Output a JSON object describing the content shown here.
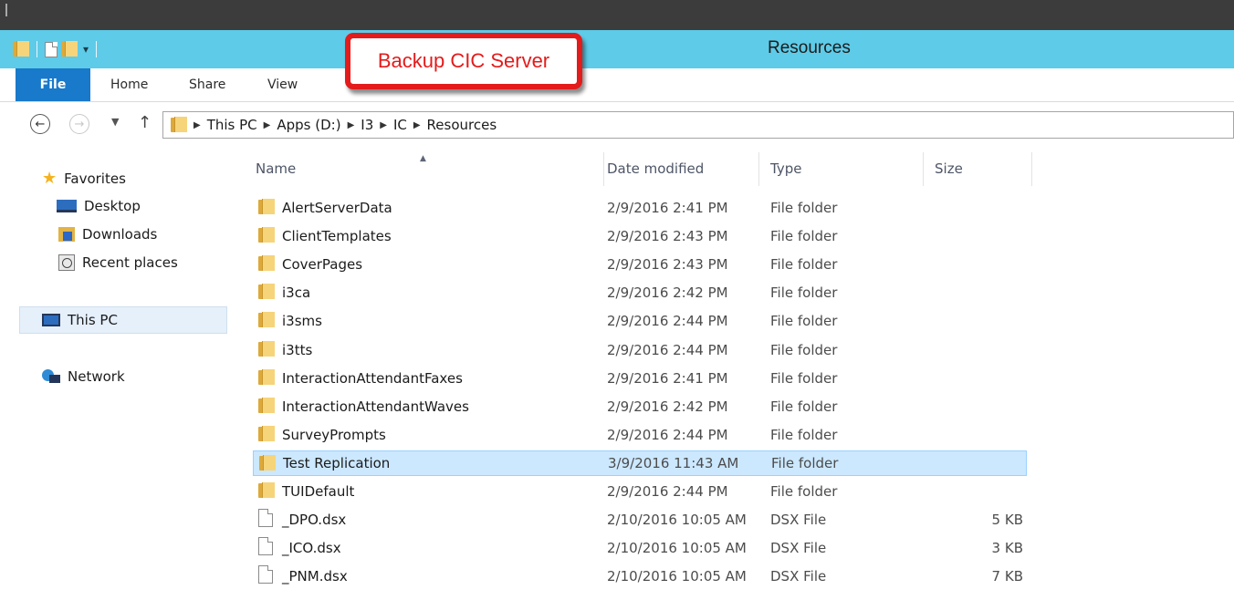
{
  "window": {
    "title": "Resources"
  },
  "ribbon": {
    "tabs": [
      {
        "label": "File"
      },
      {
        "label": "Home"
      },
      {
        "label": "Share"
      },
      {
        "label": "View"
      }
    ]
  },
  "annotation": {
    "callout_text": "Backup CIC Server",
    "color": "#e41b1b"
  },
  "address": {
    "breadcrumbs": [
      "This PC",
      "Apps (D:)",
      "I3",
      "IC",
      "Resources"
    ]
  },
  "navpane": {
    "favorites_label": "Favorites",
    "favorites": [
      {
        "label": "Desktop",
        "icon": "desktop-icon"
      },
      {
        "label": "Downloads",
        "icon": "downloads-icon"
      },
      {
        "label": "Recent places",
        "icon": "recent-places-icon"
      }
    ],
    "this_pc_label": "This PC",
    "network_label": "Network"
  },
  "columns": {
    "name": "Name",
    "date": "Date modified",
    "type": "Type",
    "size": "Size"
  },
  "files": [
    {
      "name": "AlertServerData",
      "date": "2/9/2016 2:41 PM",
      "type": "File folder",
      "size": "",
      "kind": "folder"
    },
    {
      "name": "ClientTemplates",
      "date": "2/9/2016 2:43 PM",
      "type": "File folder",
      "size": "",
      "kind": "folder"
    },
    {
      "name": "CoverPages",
      "date": "2/9/2016 2:43 PM",
      "type": "File folder",
      "size": "",
      "kind": "folder"
    },
    {
      "name": "i3ca",
      "date": "2/9/2016 2:42 PM",
      "type": "File folder",
      "size": "",
      "kind": "folder"
    },
    {
      "name": "i3sms",
      "date": "2/9/2016 2:44 PM",
      "type": "File folder",
      "size": "",
      "kind": "folder"
    },
    {
      "name": "i3tts",
      "date": "2/9/2016 2:44 PM",
      "type": "File folder",
      "size": "",
      "kind": "folder"
    },
    {
      "name": "InteractionAttendantFaxes",
      "date": "2/9/2016 2:41 PM",
      "type": "File folder",
      "size": "",
      "kind": "folder"
    },
    {
      "name": "InteractionAttendantWaves",
      "date": "2/9/2016 2:42 PM",
      "type": "File folder",
      "size": "",
      "kind": "folder"
    },
    {
      "name": "SurveyPrompts",
      "date": "2/9/2016 2:44 PM",
      "type": "File folder",
      "size": "",
      "kind": "folder"
    },
    {
      "name": "Test Replication",
      "date": "3/9/2016 11:43 AM",
      "type": "File folder",
      "size": "",
      "kind": "folder",
      "selected": true
    },
    {
      "name": "TUIDefault",
      "date": "2/9/2016 2:44 PM",
      "type": "File folder",
      "size": "",
      "kind": "folder"
    },
    {
      "name": "_DPO.dsx",
      "date": "2/10/2016 10:05 AM",
      "type": "DSX File",
      "size": "5 KB",
      "kind": "file"
    },
    {
      "name": "_ICO.dsx",
      "date": "2/10/2016 10:05 AM",
      "type": "DSX File",
      "size": "3 KB",
      "kind": "file"
    },
    {
      "name": "_PNM.dsx",
      "date": "2/10/2016 10:05 AM",
      "type": "DSX File",
      "size": "7 KB",
      "kind": "file"
    }
  ],
  "colors": {
    "titlebar": "#5ecbe8",
    "file_tab": "#1979ca",
    "selection": "#cce8ff"
  }
}
